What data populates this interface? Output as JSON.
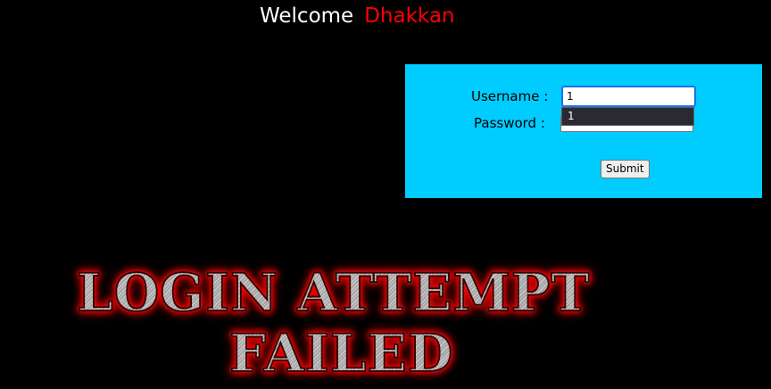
{
  "header": {
    "welcome_text": "Welcome",
    "user_name": "Dhakkan"
  },
  "login_form": {
    "username_label": "Username :",
    "username_value": "1",
    "password_label": "Password :",
    "password_value": "",
    "autofill_suggestion": "1",
    "submit_label": "Submit"
  },
  "banner": {
    "line1": "LOGIN ATTEMPT",
    "line2": "FAILED"
  },
  "colors": {
    "background": "#000000",
    "panel": "#00ccff",
    "user_name": "#ff0000",
    "banner_glow": "#ff0000"
  }
}
